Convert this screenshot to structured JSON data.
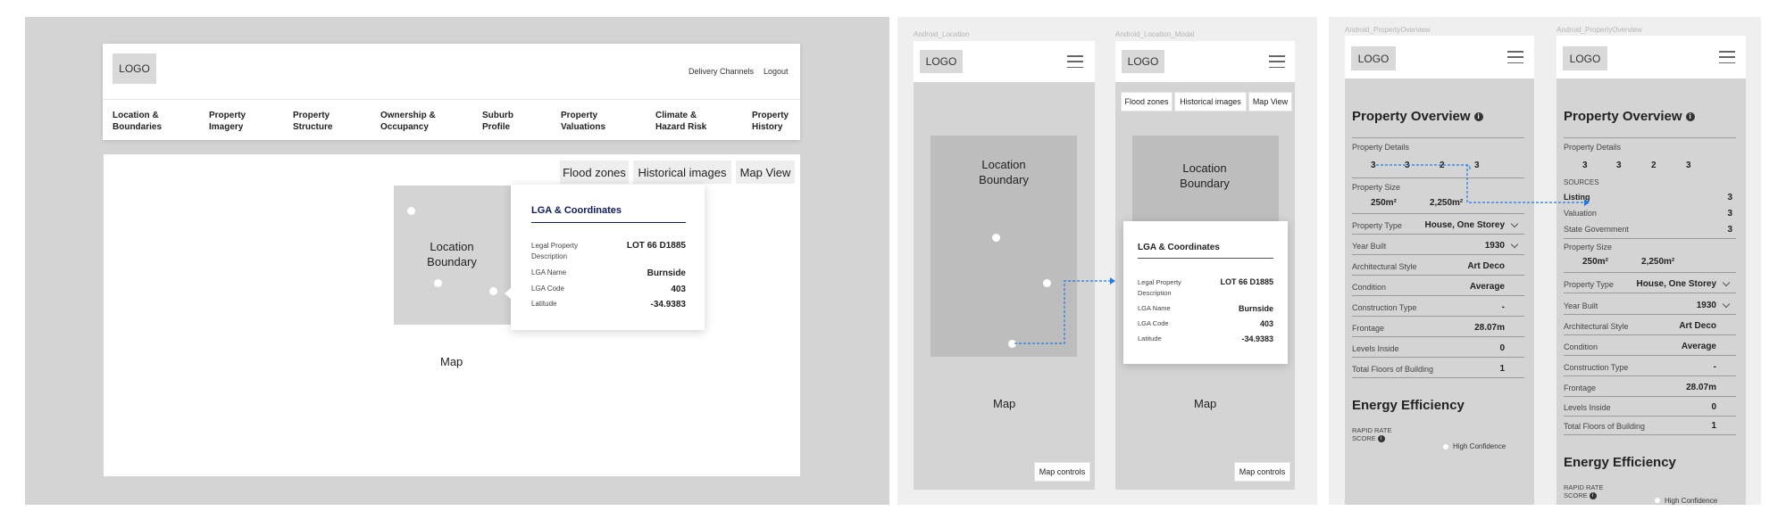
{
  "desktop": {
    "logo": "LOGO",
    "header_links": [
      "Delivery Channels",
      "Logout"
    ],
    "nav": [
      {
        "line1": "Location &",
        "line2": "Boundaries"
      },
      {
        "line1": "Property",
        "line2": "Imagery"
      },
      {
        "line1": "Property",
        "line2": "Structure"
      },
      {
        "line1": "Ownership &",
        "line2": "Occupancy"
      },
      {
        "line1": "Suburb",
        "line2": "Profile"
      },
      {
        "line1": "Property",
        "line2": "Valuations"
      },
      {
        "line1": "Climate &",
        "line2": "Hazard Risk"
      },
      {
        "line1": "Property",
        "line2": "History"
      }
    ],
    "map_buttons": [
      "Flood zones",
      "Historical images",
      "Map View"
    ],
    "boundary_label": {
      "line1": "Location",
      "line2": "Boundary"
    },
    "map_label": "Map"
  },
  "lga_card": {
    "title": "LGA & Coordinates",
    "rows": [
      {
        "key_line1": "Legal Property",
        "key_line2": "Description",
        "value": "LOT 66 D1885"
      },
      {
        "key_line1": "LGA Name",
        "key_line2": "",
        "value": "Burnside"
      },
      {
        "key_line1": "LGA Code",
        "key_line2": "",
        "value": "403"
      },
      {
        "key_line1": "Latitude",
        "key_line2": "",
        "value": "-34.9383"
      }
    ]
  },
  "android_location": {
    "frame_label": "Android_Location",
    "logo": "LOGO",
    "boundary_label": {
      "line1": "Location",
      "line2": "Boundary"
    },
    "map_label": "Map",
    "map_controls": "Map controls"
  },
  "android_location_modal": {
    "frame_label": "Android_Location_Modal",
    "logo": "LOGO",
    "buttons": [
      "Flood zones",
      "Historical images",
      "Map View"
    ],
    "boundary_label": {
      "line1": "Location",
      "line2": "Boundary"
    },
    "map_label": "Map",
    "map_controls": "Map controls"
  },
  "overview_a": {
    "frame_label": "Android_PropertyOverview",
    "logo": "LOGO",
    "title": "Property Overview",
    "details_label": "Property Details",
    "detail_counts": [
      "3",
      "3",
      "2",
      "3"
    ],
    "size_label": "Property Size",
    "sizes": [
      "250m²",
      "2,250m²"
    ],
    "rows": [
      {
        "label": "Property Type",
        "value": "House, One Storey"
      },
      {
        "label": "Year Built",
        "value": "1930"
      },
      {
        "label": "Architectural Style",
        "value": "Art Deco"
      },
      {
        "label": "Condition",
        "value": "Average"
      },
      {
        "label": "Construction Type",
        "value": "-"
      },
      {
        "label": "Frontage",
        "value": "28.07m"
      },
      {
        "label": "Levels Inside",
        "value": "0"
      },
      {
        "label": "Total Floors of Building",
        "value": "1"
      }
    ],
    "energy_title": "Energy Efficiency",
    "rapid_line1": "RAPID RATE",
    "rapid_line2": "SCORE",
    "confidence": "High Confidence"
  },
  "overview_b": {
    "frame_label": "Android_PropertyOverview",
    "logo": "LOGO",
    "title": "Property Overview",
    "details_label": "Property Details",
    "detail_counts": [
      "3",
      "3",
      "2",
      "3"
    ],
    "sources_label": "SOURCES",
    "sources": [
      {
        "label": "Listing",
        "value": "3"
      },
      {
        "label": "Valuation",
        "value": "3"
      },
      {
        "label": "State Government",
        "value": "3"
      }
    ],
    "size_label": "Property Size",
    "sizes": [
      "250m²",
      "2,250m²"
    ],
    "rows": [
      {
        "label": "Property Type",
        "value": "House, One Storey"
      },
      {
        "label": "Year Built",
        "value": "1930"
      },
      {
        "label": "Architectural Style",
        "value": "Art Deco"
      },
      {
        "label": "Condition",
        "value": "Average"
      },
      {
        "label": "Construction Type",
        "value": "-"
      },
      {
        "label": "Frontage",
        "value": "28.07m"
      },
      {
        "label": "Levels Inside",
        "value": "0"
      },
      {
        "label": "Total Floors of Building",
        "value": "1"
      }
    ],
    "energy_title": "Energy Efficiency",
    "rapid_line1": "RAPID RATE",
    "rapid_line2": "SCORE",
    "confidence": "High Confidence"
  },
  "colors": {
    "accent": "#0d1b5e",
    "connector": "#1e7be6",
    "canvas": "#d4d4d4"
  },
  "icons": [
    "hamburger-menu-icon",
    "info-icon",
    "chevron-down-icon"
  ]
}
